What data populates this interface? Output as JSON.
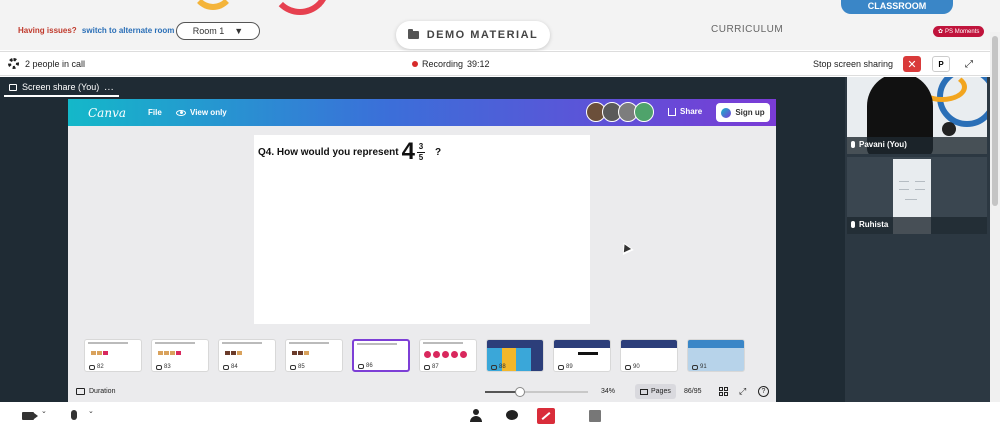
{
  "topbar": {
    "issues_question": "Having issues?",
    "issues_link": "switch to alternate room",
    "room_select": "Room 1",
    "demo_material": "DEMO MATERIAL",
    "curriculum": "CURRICULUM",
    "classroom": "CLASSROOM",
    "ps_moments": "PS Moments"
  },
  "callbar": {
    "people": "2 people in call",
    "recording_label": "Recording",
    "recording_time": "39:12",
    "stop_sharing": "Stop screen sharing",
    "p_button": "P"
  },
  "share": {
    "tab_label": "Screen share (You)",
    "tab_more": "..."
  },
  "canva": {
    "logo": "Canva",
    "file": "File",
    "view_only": "View only",
    "share": "Share",
    "sign_up": "Sign up",
    "slide": {
      "question_prefix": "Q4. How would you represent",
      "whole": "4",
      "numerator": "3",
      "denominator": "5",
      "question_suffix": "?"
    },
    "thumbnails": [
      {
        "num": "82"
      },
      {
        "num": "83"
      },
      {
        "num": "84"
      },
      {
        "num": "85"
      },
      {
        "num": "86",
        "selected": true
      },
      {
        "num": "87"
      },
      {
        "num": "88"
      },
      {
        "num": "89"
      },
      {
        "num": "90"
      },
      {
        "num": "91"
      }
    ],
    "duration": "Duration",
    "zoom": "34%",
    "zoom_fraction": 0.34,
    "pages": "Pages",
    "page_count": "86/95",
    "help": "?"
  },
  "tiles": [
    {
      "name": "Pavani (You)"
    },
    {
      "name": "Ruhista"
    }
  ],
  "colors": {
    "accent_blue": "#3a86c7",
    "record_red": "#d62a2a",
    "canva_purple": "#7d3fd6",
    "share_red": "#d92d3a"
  }
}
